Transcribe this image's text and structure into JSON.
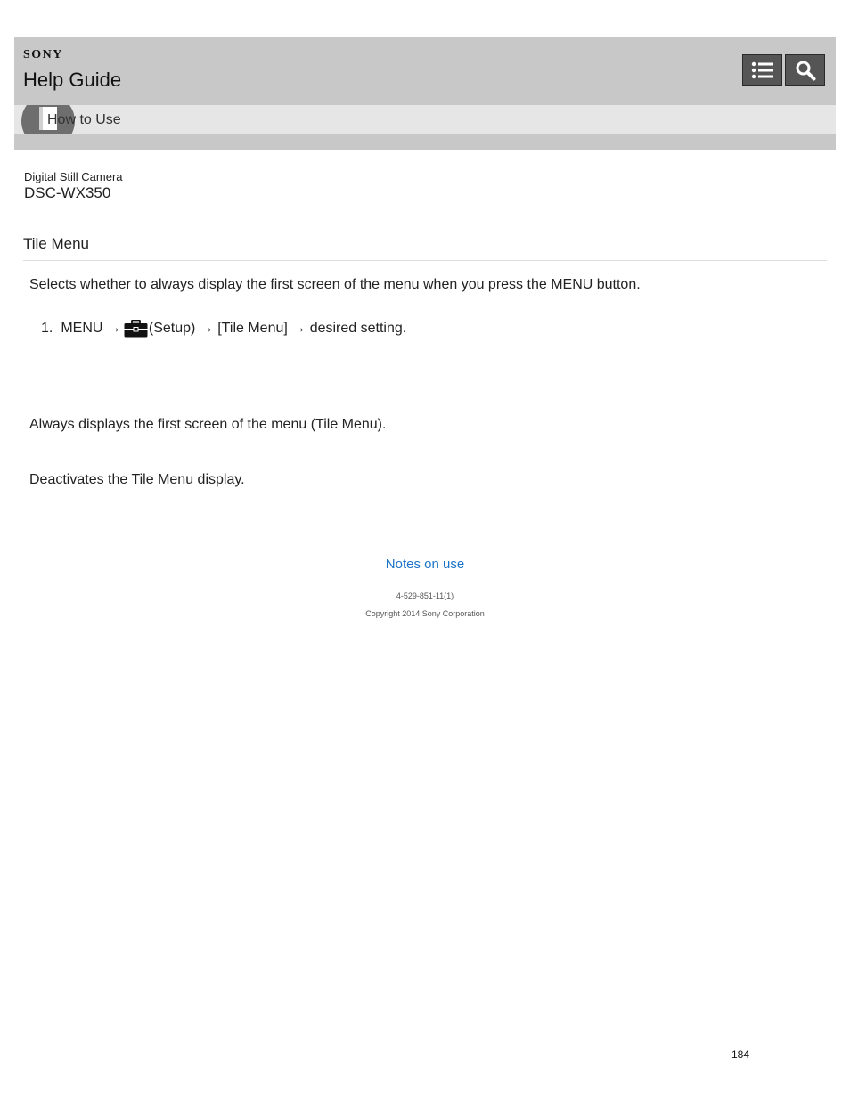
{
  "header": {
    "brand": "SONY",
    "title": "Help Guide",
    "list_icon": "list-icon",
    "search_icon": "search-icon",
    "colors": {
      "bar": "#c8c8c8",
      "subbar": "#e6e6e6",
      "button": "#555555"
    }
  },
  "breadcrumb": {
    "label": "How to Use",
    "icon": "book-icon"
  },
  "product": {
    "type": "Digital Still Camera",
    "model": "DSC-WX350"
  },
  "page": {
    "title": "Tile Menu",
    "intro": "Selects whether to always display the first screen of the menu when you press the MENU button.",
    "step": {
      "number": "1.",
      "prefix": "MENU →",
      "icon": "toolbox-icon",
      "suffix": "(Setup) → [Tile Menu] → desired setting."
    },
    "option_on": "Always displays the first screen of the menu (Tile Menu).",
    "option_off": "Deactivates the Tile Menu display."
  },
  "footer": {
    "link": "Notes on use",
    "link_color": "#1a73c8",
    "code": "4-529-851-11(1)",
    "copyright": "Copyright 2014 Sony Corporation",
    "page_number": "184"
  }
}
